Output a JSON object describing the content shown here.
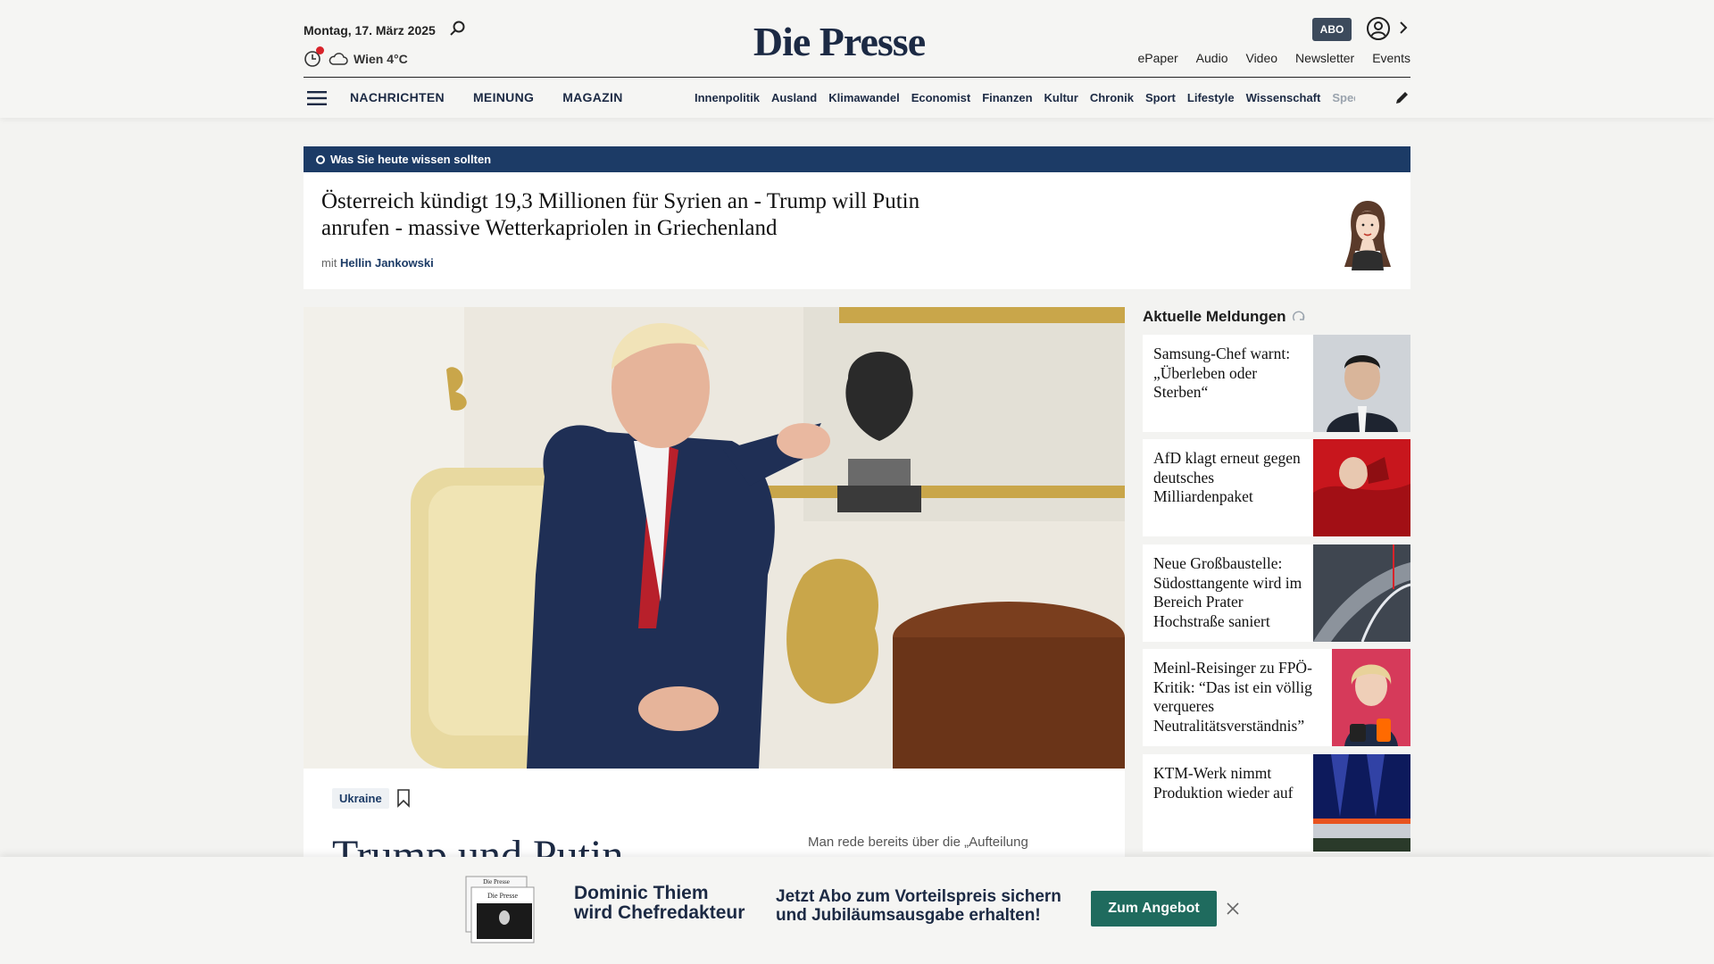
{
  "header": {
    "date": "Montag, 17. März 2025",
    "weather": "Wien 4°C",
    "logo": "Die Presse",
    "abo_label": "ABO",
    "top_links": [
      "ePaper",
      "Audio",
      "Video",
      "Newsletter",
      "Events"
    ],
    "main_nav": [
      "NACHRICHTEN",
      "MEINUNG",
      "MAGAZIN"
    ],
    "sub_nav": [
      "Innenpolitik",
      "Ausland",
      "Klimawandel",
      "Economist",
      "Finanzen",
      "Kultur",
      "Chronik",
      "Sport",
      "Lifestyle",
      "Wissenschaft",
      "Spectrum"
    ]
  },
  "briefing": {
    "label": "Was Sie heute wissen sollten",
    "title": "Österreich kündigt 19,3 Millionen für Syrien an - Trump will Putin anrufen - massive Wetterkapriolen in Griechenland",
    "author_prefix": "mit",
    "author": "Hellin Jankowski"
  },
  "hero": {
    "tag": "Ukraine",
    "title": "Trump und Putin",
    "teaser": "Man rede bereits über die „Aufteilung"
  },
  "sidebar": {
    "heading": "Aktuelle Meldungen",
    "items": [
      {
        "title": "Samsung-Chef warnt: „Überleben oder Sterben“"
      },
      {
        "title": "AfD klagt erneut gegen deutsches Milliardenpaket"
      },
      {
        "title": "Neue Großbaustelle: Südosttangente wird im Bereich Prater Hochstraße saniert"
      },
      {
        "title": "Meinl-Reisinger zu FPÖ-Kritik: “Das ist ein völlig verqueres Neutralitätsverständnis”"
      },
      {
        "title": "KTM-Werk nimmt Produktion wieder auf"
      }
    ]
  },
  "banner": {
    "headline_1": "Dominic Thiem",
    "headline_2": "wird Chefredakteur",
    "text_1": "Jetzt Abo zum Vorteilspreis sichern",
    "text_2": "und Jubiläumsausgabe erhalten!",
    "button": "Zum Angebot",
    "paper_logo": "Die Presse"
  },
  "colors": {
    "brand_navy": "#1c2a44",
    "briefing_bar": "#1c3b66",
    "cta_green": "#1f6b5e",
    "alert_red": "#d8232a"
  }
}
